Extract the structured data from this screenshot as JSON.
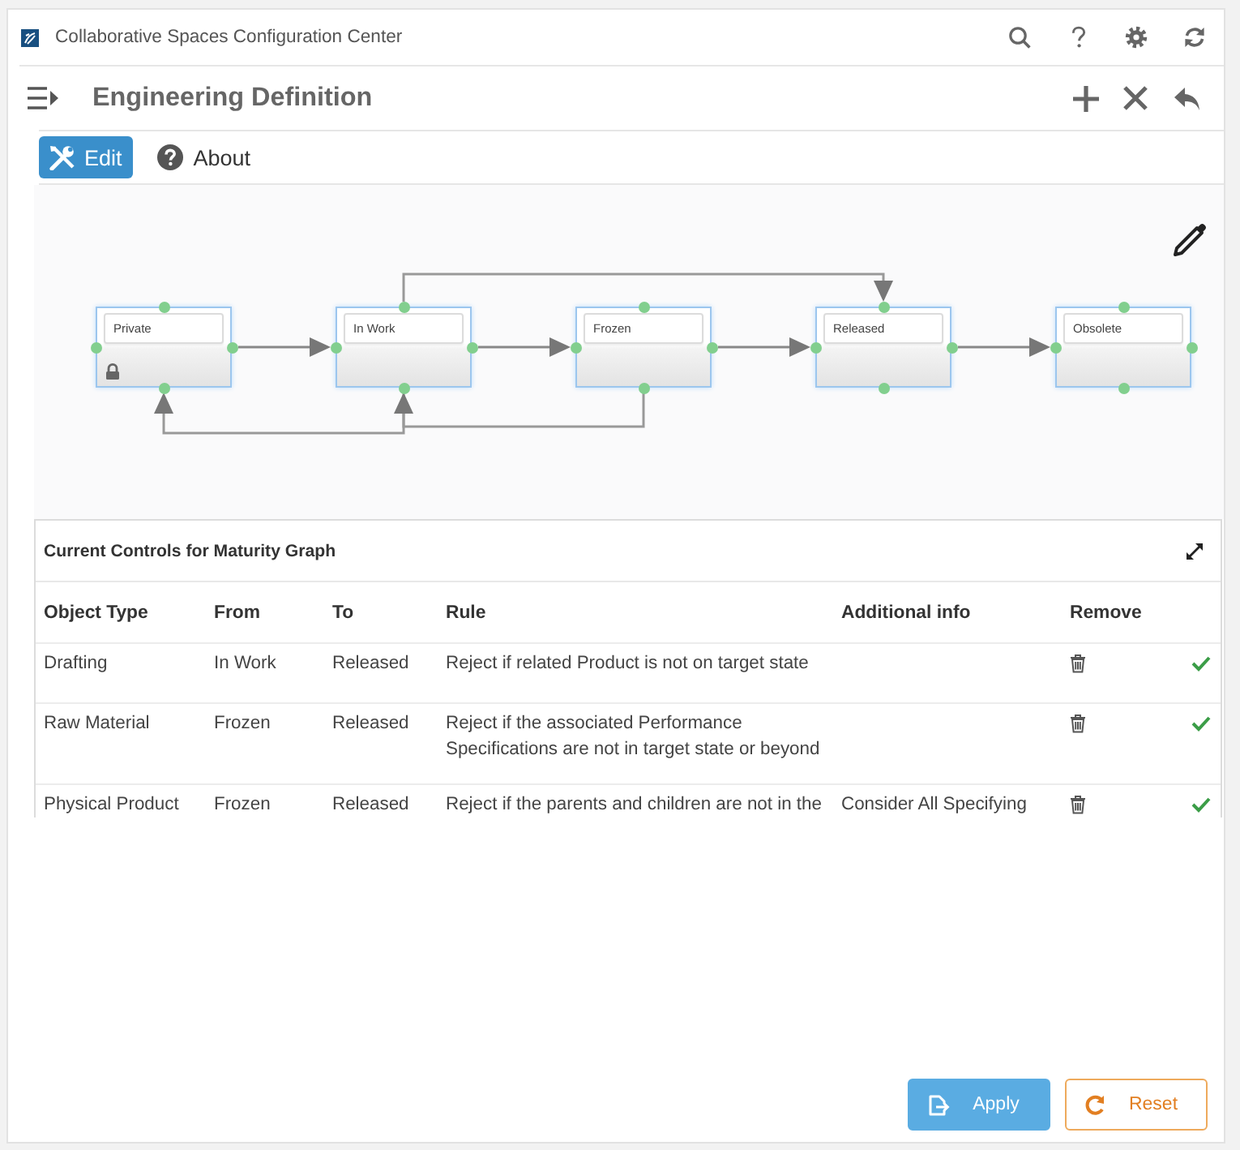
{
  "app_bar": {
    "title": "Collaborative Spaces Configuration Center"
  },
  "header": {
    "title": "Engineering Definition"
  },
  "tabs": [
    {
      "label": "Edit",
      "selected": true
    },
    {
      "label": "About",
      "selected": false
    }
  ],
  "graph": {
    "states": [
      {
        "name": "Private",
        "locked": true,
        "transitions": [
          {
            "kind": "next"
          }
        ]
      },
      {
        "name": "In Work",
        "locked": false,
        "transitions": [
          {
            "kind": "next"
          },
          {
            "kind": "skip"
          },
          {
            "kind": "back"
          }
        ]
      },
      {
        "name": "Frozen",
        "locked": false,
        "transitions": [
          {
            "kind": "next"
          },
          {
            "kind": "back"
          }
        ]
      },
      {
        "name": "Released",
        "locked": false,
        "transitions": [
          {
            "kind": "next"
          }
        ]
      },
      {
        "name": "Obsolete",
        "locked": false
      }
    ]
  },
  "controls_table": {
    "title": "Current Controls for Maturity Graph",
    "columns": [
      "Object Type",
      "From",
      "To",
      "Rule",
      "Additional info",
      "Remove"
    ],
    "rows": [
      {
        "object_type": "Drafting",
        "from": "In Work",
        "to": "Released",
        "rule": "Reject if related Product is not on target state",
        "active": true
      },
      {
        "object_type": "Raw Material",
        "from": "Frozen",
        "to": "Released",
        "rule": "Reject if the associated Performance Specifications are not in target state or beyond",
        "active": true
      },
      {
        "object_type": "Physical Product",
        "from": "Frozen",
        "to": "Released",
        "rule": "Reject if the parents and children are not in the",
        "additional_info": "Consider All Specifying",
        "active": true
      }
    ]
  },
  "actions": [
    {
      "label": "Apply",
      "kind": "primary"
    },
    {
      "label": "Reset",
      "kind": "secondary"
    }
  ]
}
